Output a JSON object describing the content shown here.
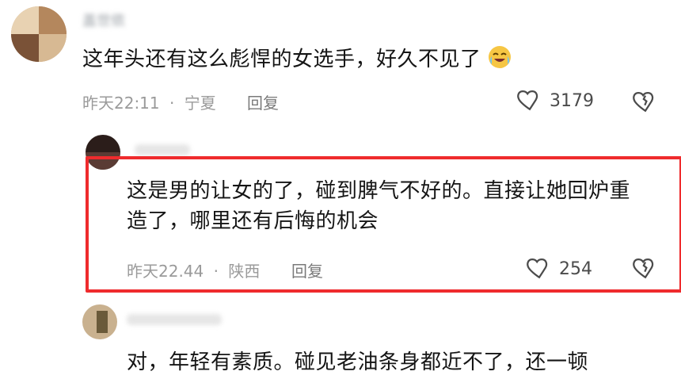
{
  "comments": [
    {
      "username": "盖世侬",
      "text": "这年头还有这么彪悍的女选手，好久不见了",
      "emoji": "crying-laughing-face",
      "time": "昨天22:11",
      "location": "宁夏",
      "reply_label": "回复",
      "likes": "3179"
    },
    {
      "username": "",
      "text_line1": "这是男的让女的了，碰到脾气不好的。直接让她回炉重",
      "text_line2": "造了，哪里还有后悔的机会",
      "time": "昨天22.44",
      "location": "陕西",
      "reply_label": "回复",
      "likes": "254"
    },
    {
      "username": "",
      "text": "对，年轻有素质。碰见老油条身都近不了，还一顿"
    }
  ],
  "separator": "·",
  "colors": {
    "highlight": "#ef2b2d",
    "meta": "#9a9a9a"
  }
}
